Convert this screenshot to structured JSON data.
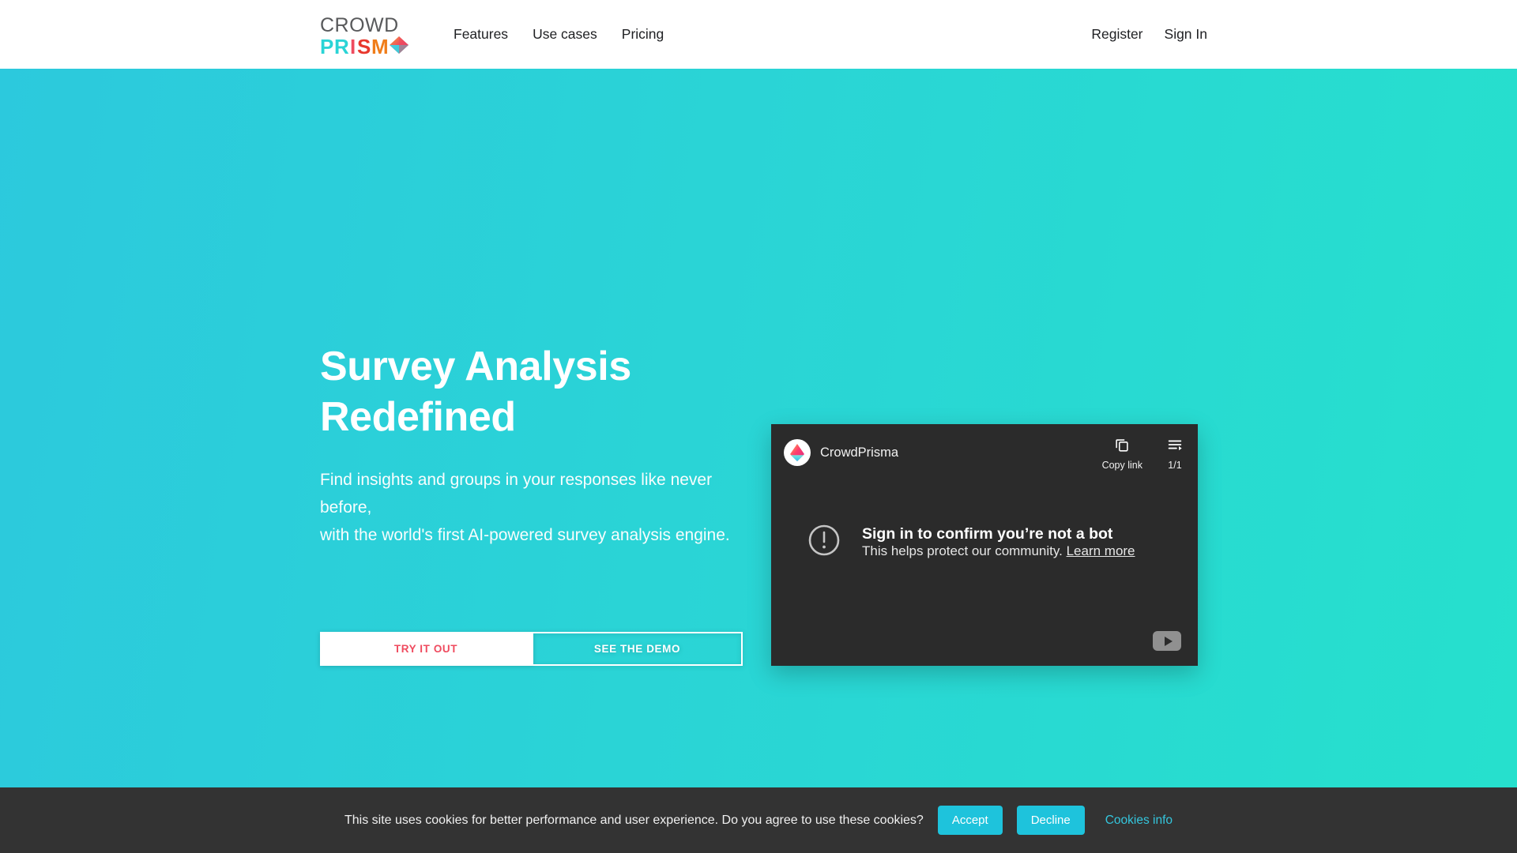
{
  "header": {
    "logo": {
      "line1": "CROWD",
      "line2": "PRISM",
      "icon": "prism-logo-icon",
      "colors": {
        "crowd": "#58595b",
        "p": "#2ad4d6",
        "r": "#2ad4d6",
        "i": "#ef4b5f",
        "s": "#e8382d",
        "m": "#f07d1a"
      }
    },
    "nav": [
      {
        "label": "Features",
        "name": "nav-features"
      },
      {
        "label": "Use cases",
        "name": "nav-use-cases"
      },
      {
        "label": "Pricing",
        "name": "nav-pricing"
      }
    ],
    "auth": [
      {
        "label": "Register",
        "name": "nav-register"
      },
      {
        "label": "Sign In",
        "name": "nav-sign-in"
      }
    ]
  },
  "hero": {
    "title": "Survey Analysis\nRedefined",
    "subtitle": "Find insights and groups in your responses like never before,\nwith the world's first AI-powered survey analysis engine.",
    "primary_button": "TRY IT OUT",
    "secondary_button": "SEE THE DEMO",
    "background_from": "#2cc9dd",
    "background_to": "#26e0cd",
    "primary_button_text_color": "#ef4b5f"
  },
  "video": {
    "channel_name": "CrowdPrisma",
    "avatar_icon": "prism-avatar-icon",
    "copy_link_label": "Copy link",
    "copy_link_icon": "copy-icon",
    "playlist_label": "1/1",
    "playlist_icon": "playlist-icon",
    "error_icon": "exclamation-circle-icon",
    "error_title": "Sign in to confirm you’re not a bot",
    "error_subtitle": "This helps protect our community.",
    "learn_more_label": "Learn more",
    "youtube_badge_icon": "youtube-play-icon",
    "background": "#2b2b2b"
  },
  "cookie_banner": {
    "message": "This site uses cookies for better performance and user experience. Do you agree to use these cookies?",
    "accept_label": "Accept",
    "decline_label": "Decline",
    "info_label": "Cookies info",
    "button_color": "#1ec3dc",
    "link_color": "#34c6dd",
    "background": "#333333"
  }
}
